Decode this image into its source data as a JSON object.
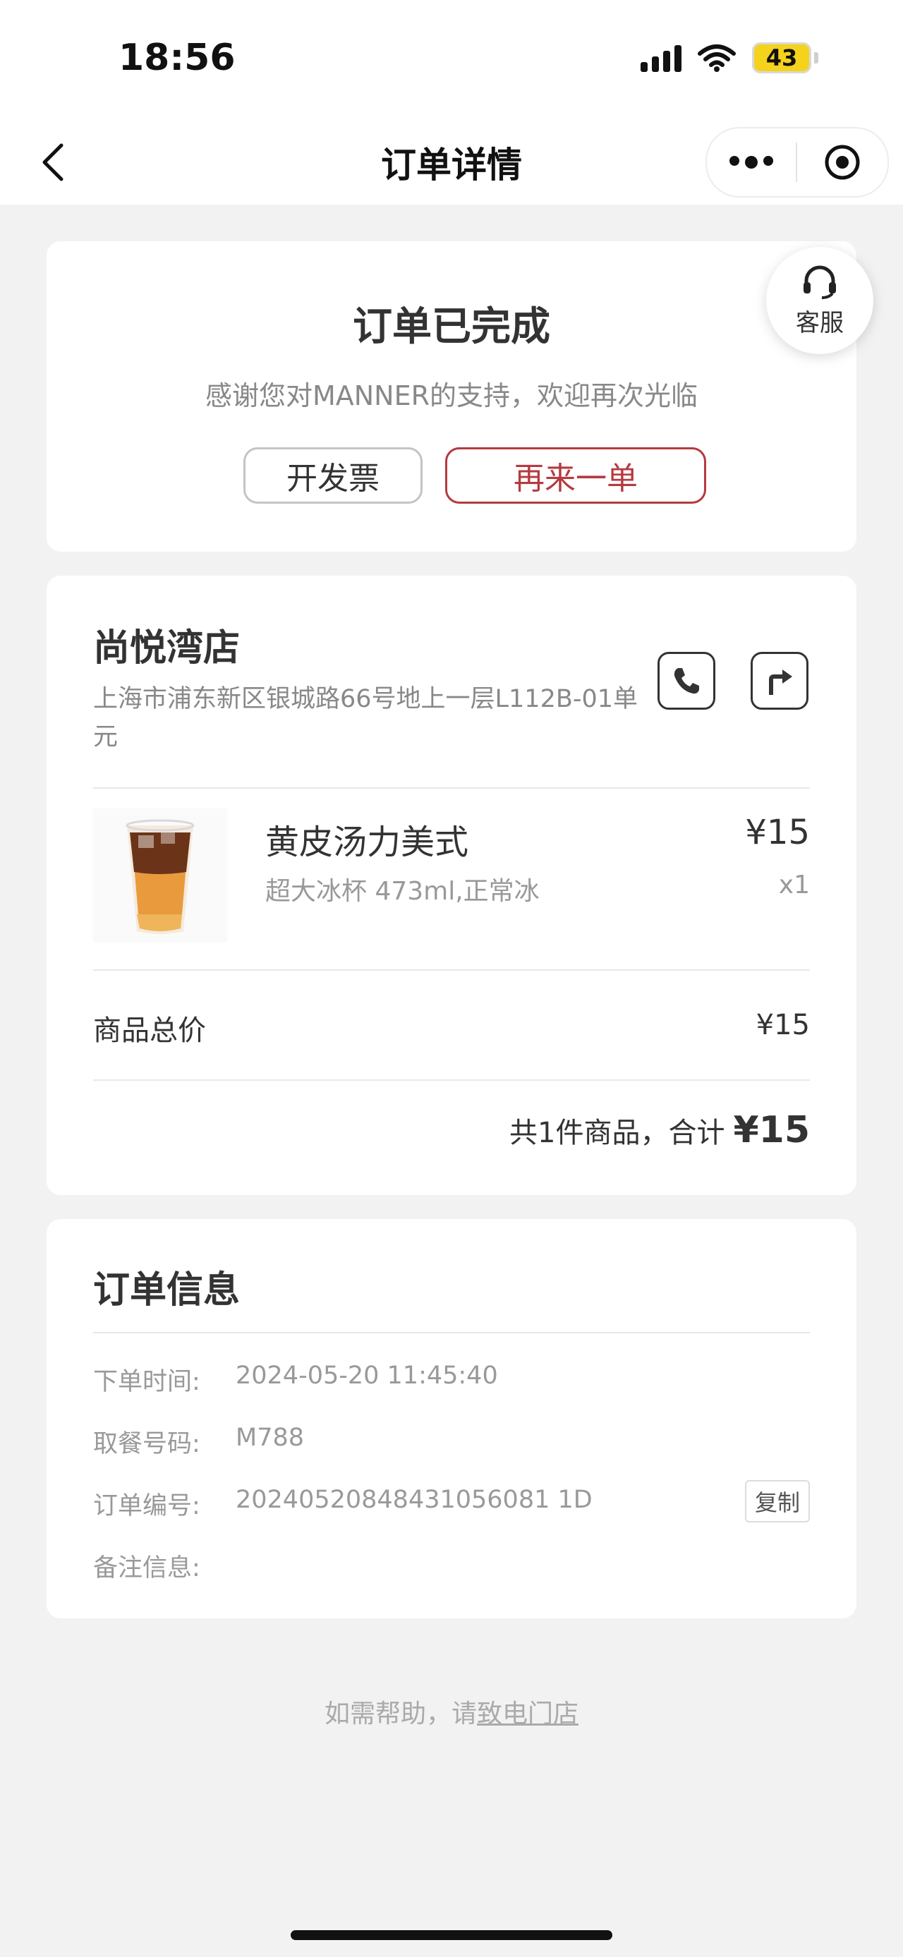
{
  "status_bar": {
    "time": "18:56",
    "battery": "43"
  },
  "nav": {
    "title": "订单详情"
  },
  "order_status": {
    "title": "订单已完成",
    "subtitle": "感谢您对MANNER的支持，欢迎再次光临",
    "invoice_label": "开发票",
    "reorder_label": "再来一单"
  },
  "customer_service": {
    "label": "客服"
  },
  "store": {
    "name": "尚悦湾店",
    "address": "上海市浦东新区银城路66号地上一层L112B-01单元"
  },
  "items": [
    {
      "name": "黄皮汤力美式",
      "spec": "超大冰杯 473ml,正常冰",
      "price": "¥15",
      "qty": "x1"
    }
  ],
  "summary": {
    "subtotal_label": "商品总价",
    "subtotal_value": "¥15",
    "total_text": "共1件商品，合计",
    "total_amount": "¥15"
  },
  "order_info": {
    "title": "订单信息",
    "rows": [
      {
        "label": "下单时间:",
        "value": "2024-05-20 11:45:40"
      },
      {
        "label": "取餐号码:",
        "value": "M788"
      },
      {
        "label": "订单编号:",
        "value": "20240520848431056081 1D"
      },
      {
        "label": "备注信息:",
        "value": ""
      }
    ],
    "copy_label": "复制"
  },
  "help": {
    "prefix": "如需帮助，请",
    "link": "致电门店"
  },
  "colors": {
    "accent": "#b53a3f",
    "battery": "#f5d21b",
    "background": "#f2f2f2"
  }
}
